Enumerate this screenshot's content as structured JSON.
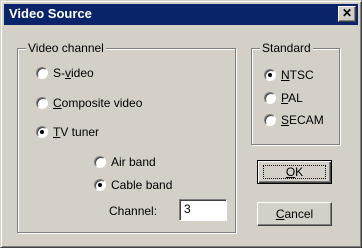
{
  "window": {
    "title": "Video Source",
    "close_glyph": "✕"
  },
  "video_channel": {
    "legend": "Video channel",
    "options": [
      {
        "before": "S-",
        "key": "v",
        "after": "ideo",
        "selected": false
      },
      {
        "before": "",
        "key": "C",
        "after": "omposite video",
        "selected": false
      },
      {
        "before": "",
        "key": "T",
        "after": "V tuner",
        "selected": true
      }
    ],
    "tuner": {
      "bands": [
        {
          "label": "Air band",
          "selected": false
        },
        {
          "label": "Cable band",
          "selected": true
        }
      ],
      "channel_label": "Channel:",
      "channel_value": "3"
    }
  },
  "standard": {
    "legend": "Standard",
    "options": [
      {
        "key": "N",
        "after": "TSC",
        "selected": true
      },
      {
        "key": "P",
        "after": "AL",
        "selected": false
      },
      {
        "key": "S",
        "after": "ECAM",
        "selected": false
      }
    ]
  },
  "buttons": {
    "ok": {
      "key": "O",
      "after": "K"
    },
    "cancel": {
      "key": "C",
      "after": "ancel"
    }
  }
}
